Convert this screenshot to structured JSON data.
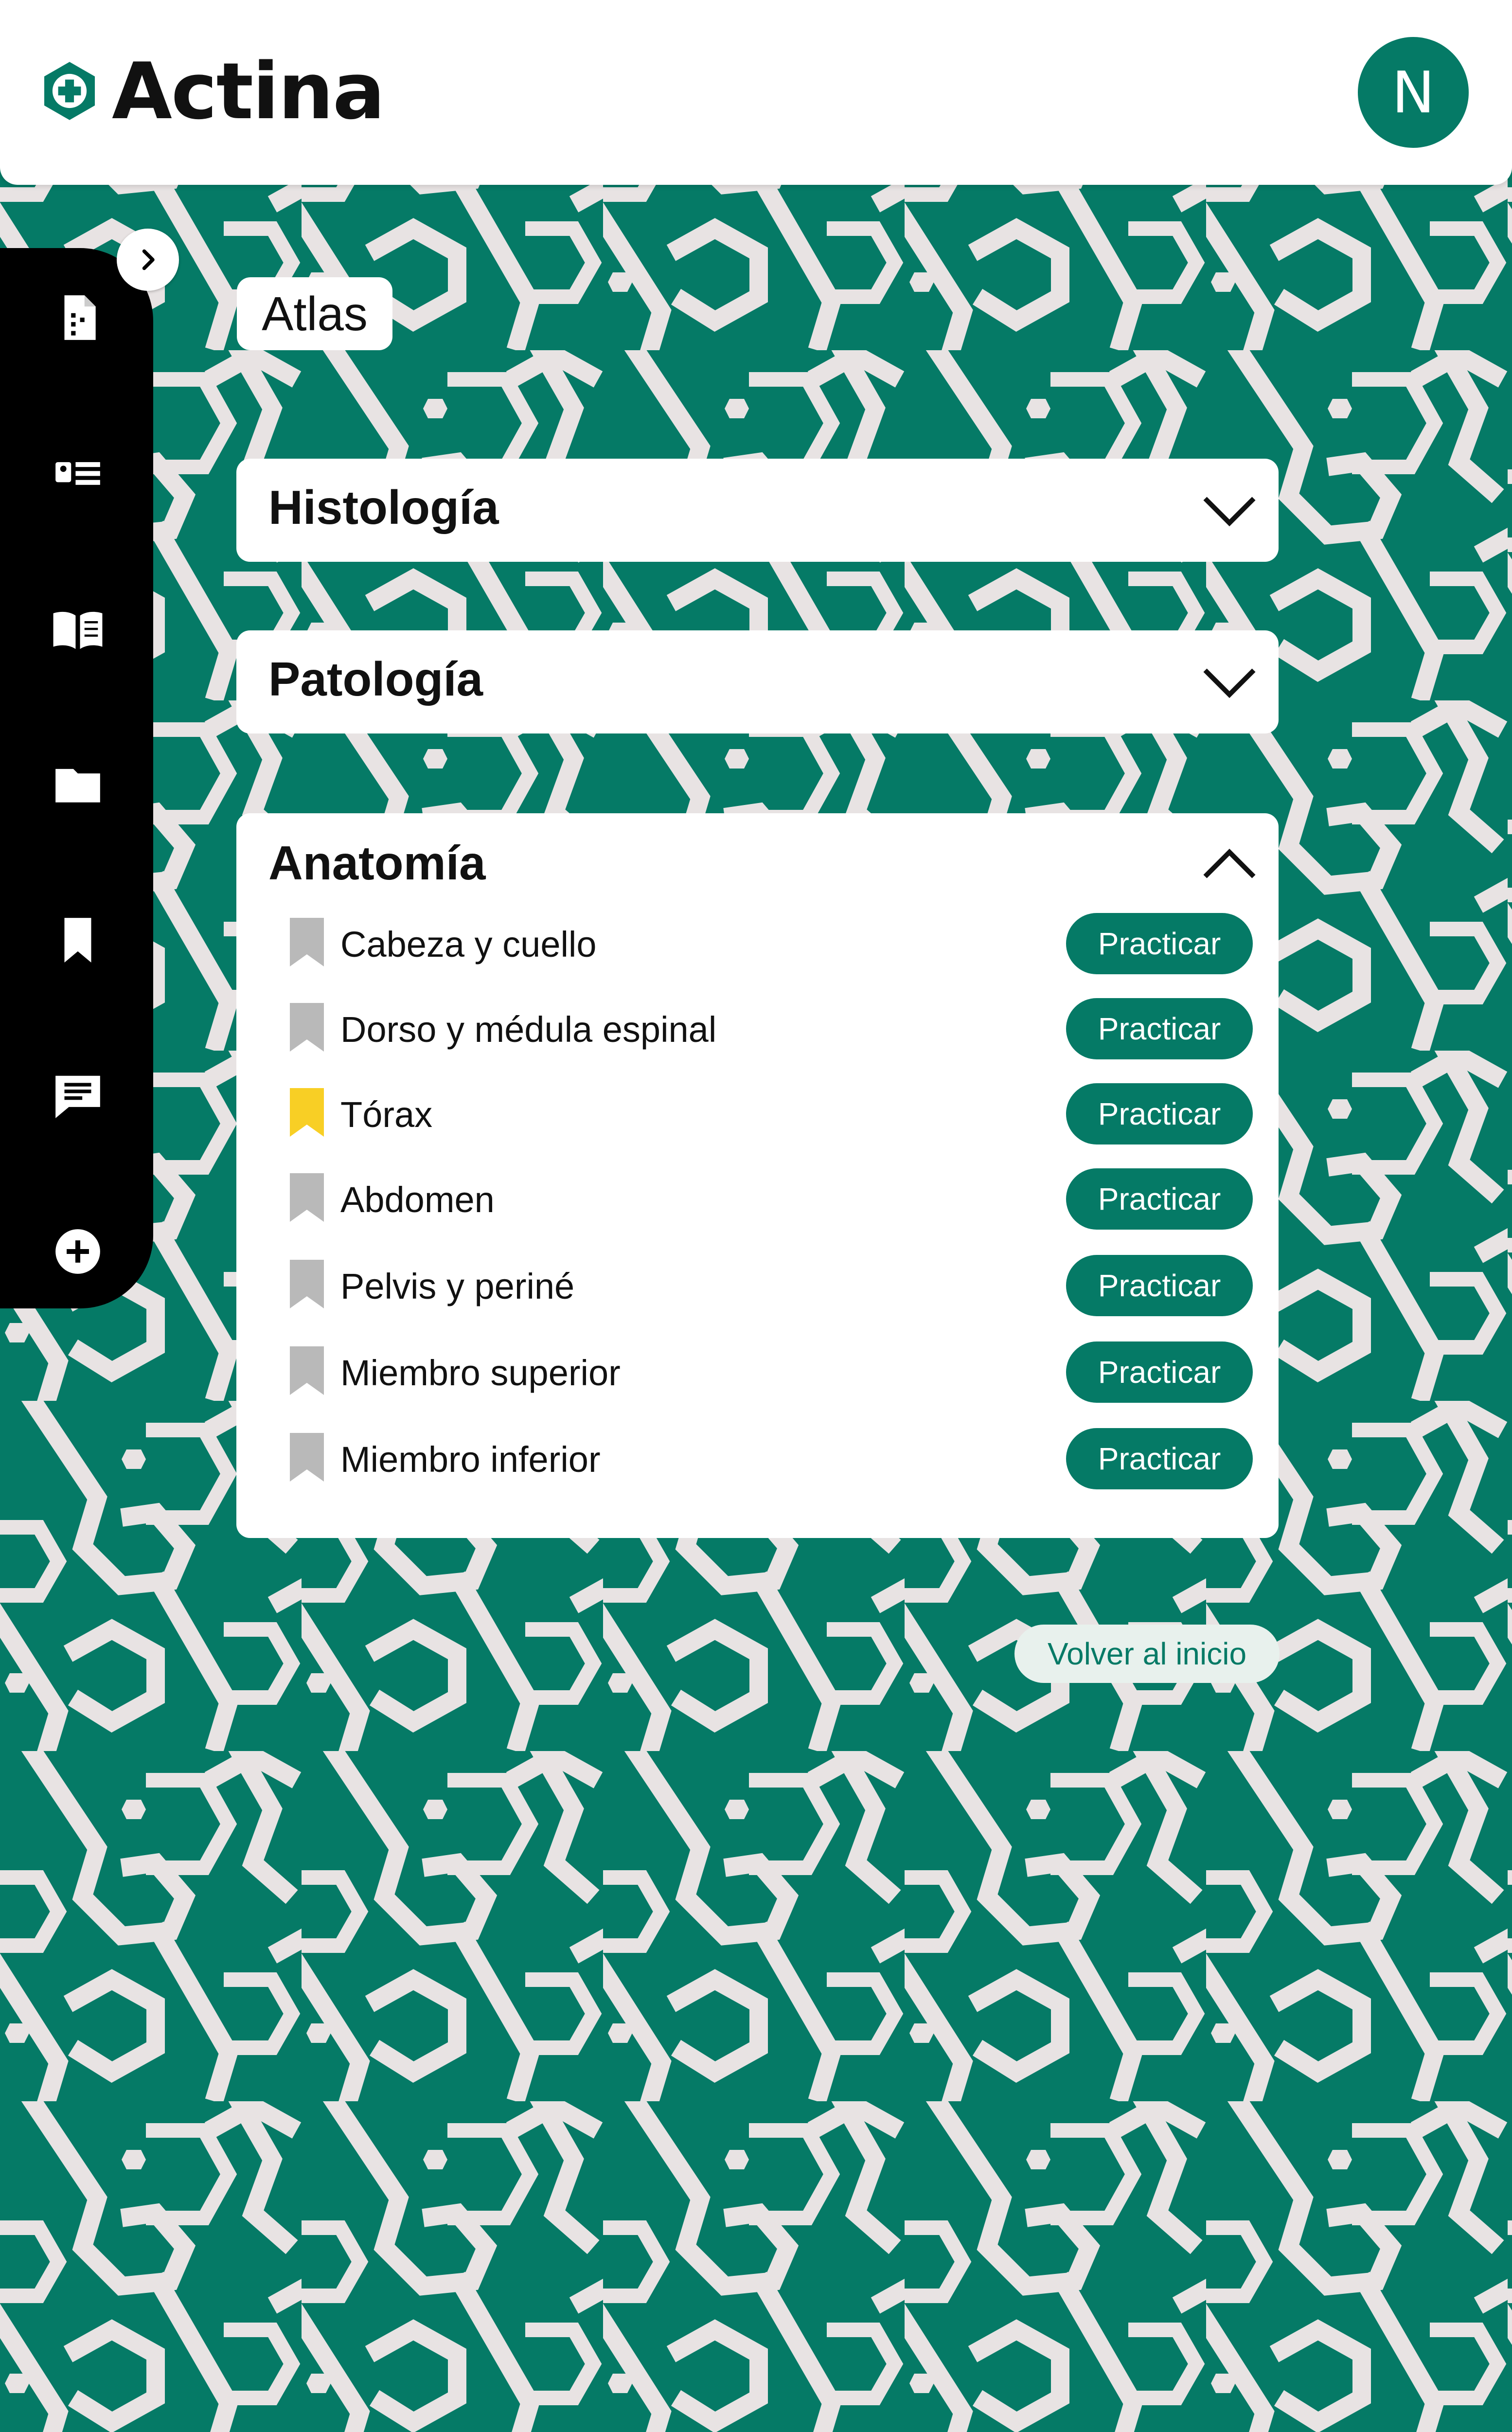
{
  "app": {
    "name": "Actina",
    "avatar_initial": "N"
  },
  "colors": {
    "accent": "#057a66",
    "bookmark_inactive": "#b9b9b9",
    "bookmark_active": "#f8cf25",
    "pattern_light": "#e8e3e3"
  },
  "sidebar": {
    "items": [
      {
        "name": "document-icon"
      },
      {
        "name": "id-card-icon"
      },
      {
        "name": "open-book-icon"
      },
      {
        "name": "folder-icon"
      },
      {
        "name": "bookmark-icon"
      },
      {
        "name": "chat-icon"
      },
      {
        "name": "add-circle-icon"
      }
    ],
    "toggle_icon": "chevron-right-icon"
  },
  "page": {
    "title": "Atlas"
  },
  "sections": [
    {
      "title": "Histología",
      "state": "collapsed",
      "icon": "chevron-down-icon"
    },
    {
      "title": "Patología",
      "state": "collapsed",
      "icon": "chevron-down-icon"
    },
    {
      "title": "Anatomía",
      "state": "expanded",
      "icon": "chevron-up-icon",
      "items": [
        {
          "label": "Cabeza y cuello",
          "bookmarked": false,
          "action": "Practicar"
        },
        {
          "label": "Dorso y médula espinal",
          "bookmarked": false,
          "action": "Practicar"
        },
        {
          "label": "Tórax",
          "bookmarked": true,
          "action": "Practicar"
        },
        {
          "label": "Abdomen",
          "bookmarked": false,
          "action": "Practicar"
        },
        {
          "label": "Pelvis y periné",
          "bookmarked": false,
          "action": "Practicar"
        },
        {
          "label": "Miembro superior",
          "bookmarked": false,
          "action": "Practicar"
        },
        {
          "label": "Miembro inferior",
          "bookmarked": false,
          "action": "Practicar"
        }
      ]
    }
  ],
  "footer": {
    "home_label": "Volver al inicio"
  }
}
